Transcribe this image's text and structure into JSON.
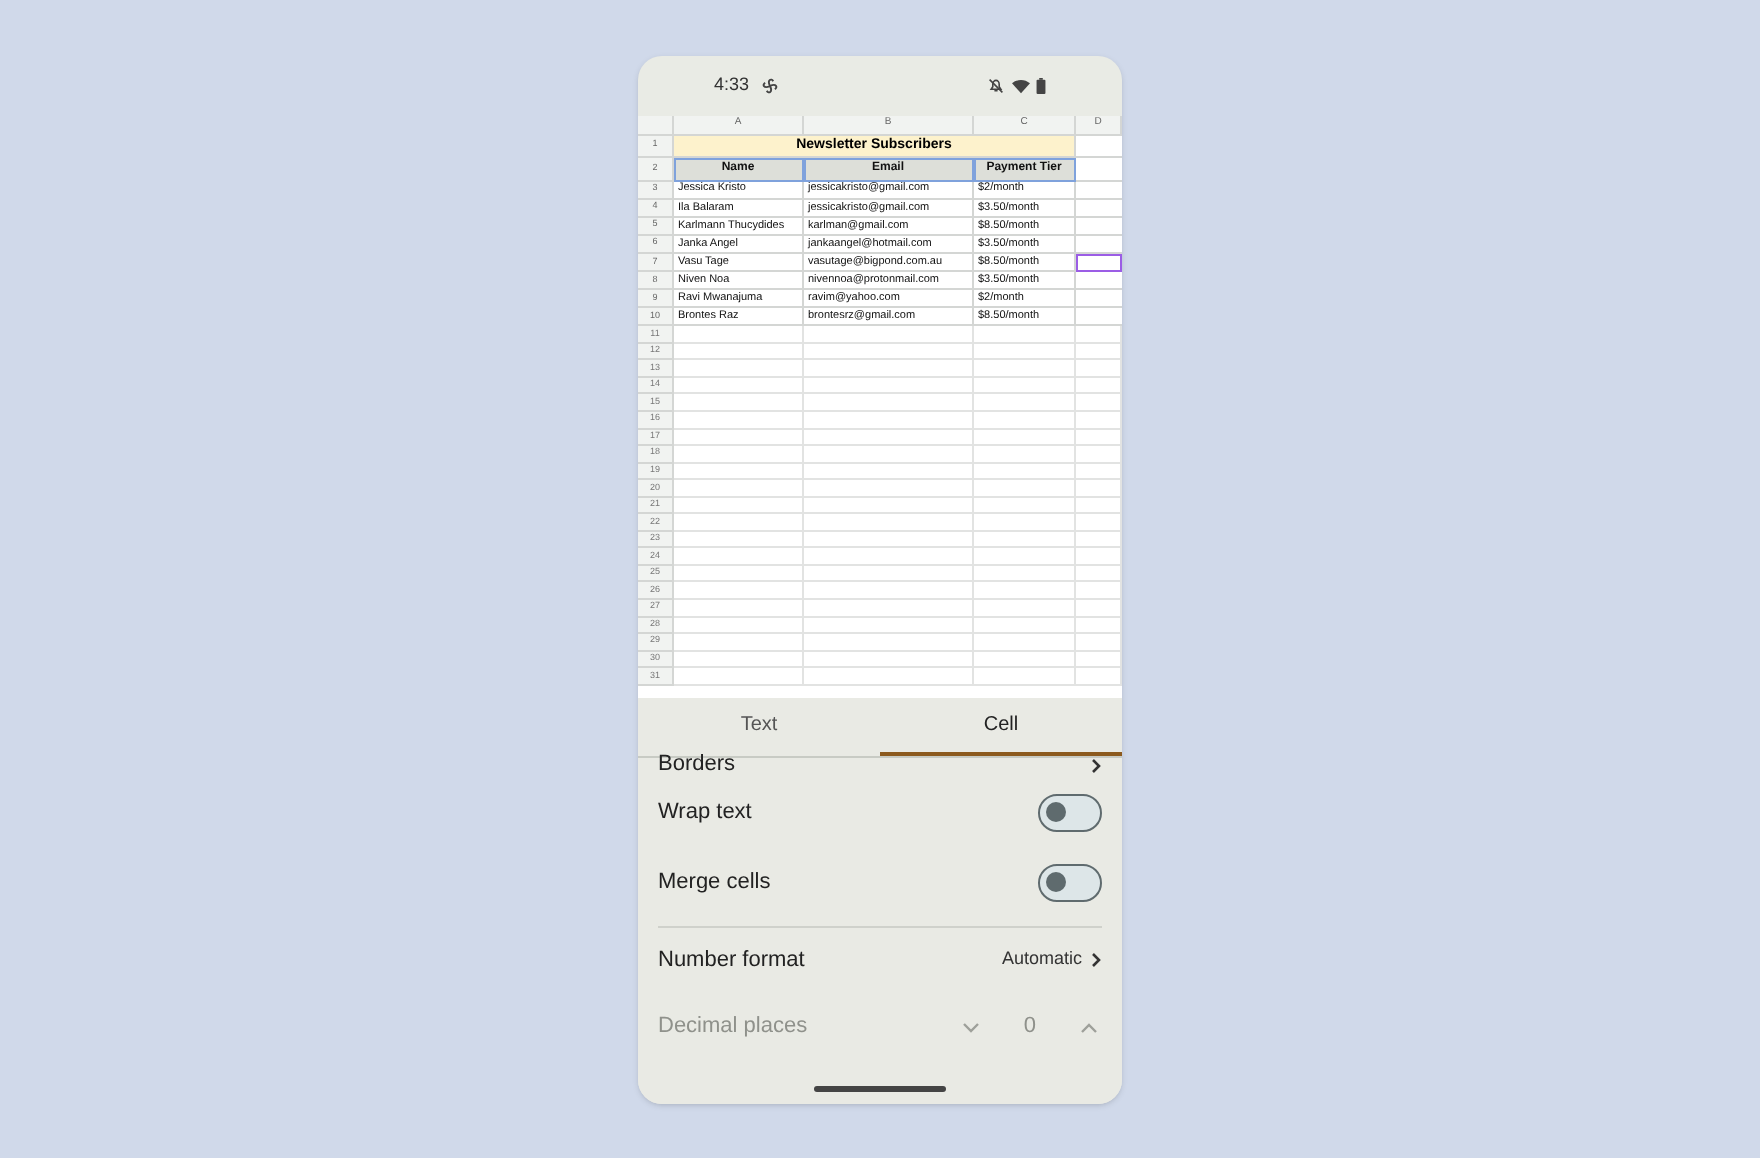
{
  "status_bar": {
    "time": "4:33"
  },
  "sheet": {
    "columns": [
      "A",
      "B",
      "C",
      "D"
    ],
    "rows": [
      {
        "number": "1",
        "kind": "title",
        "range_selected": false,
        "cursor": false,
        "title": "Newsletter Subscribers"
      },
      {
        "number": "2",
        "kind": "header",
        "range_selected": true,
        "cursor": false,
        "cells": [
          "Name",
          "Email",
          "Payment Tier"
        ]
      },
      {
        "number": "3",
        "kind": "data",
        "range_selected": false,
        "cursor": false,
        "cells": [
          "Jessica Kristo",
          "jessicakristo@gmail.com",
          "$2/month"
        ]
      },
      {
        "number": "4",
        "kind": "data",
        "range_selected": false,
        "cursor": false,
        "cells": [
          "Ila Balaram",
          "jessicakristo@gmail.com",
          "$3.50/month"
        ]
      },
      {
        "number": "5",
        "kind": "data",
        "range_selected": false,
        "cursor": false,
        "cells": [
          "Karlmann Thucydides",
          "karlman@gmail.com",
          "$8.50/month"
        ]
      },
      {
        "number": "6",
        "kind": "data",
        "range_selected": false,
        "cursor": false,
        "cells": [
          "Janka Angel",
          "jankaangel@hotmail.com",
          "$3.50/month"
        ]
      },
      {
        "number": "7",
        "kind": "data",
        "range_selected": false,
        "cursor": true,
        "cells": [
          "Vasu Tage",
          "vasutage@bigpond.com.au",
          "$8.50/month"
        ]
      },
      {
        "number": "8",
        "kind": "data",
        "range_selected": false,
        "cursor": false,
        "cells": [
          "Niven Noa",
          "nivennoa@protonmail.com",
          "$3.50/month"
        ]
      },
      {
        "number": "9",
        "kind": "data",
        "range_selected": false,
        "cursor": false,
        "cells": [
          "Ravi Mwanajuma",
          "ravim@yahoo.com",
          "$2/month"
        ]
      },
      {
        "number": "10",
        "kind": "data",
        "range_selected": false,
        "cursor": false,
        "cells": [
          "Brontes Raz",
          "brontesrz@gmail.com",
          "$8.50/month"
        ]
      }
    ],
    "empty_row_numbers": [
      "11",
      "12",
      "13",
      "14",
      "15",
      "16",
      "17",
      "18",
      "19",
      "20",
      "21",
      "22",
      "23",
      "24",
      "25",
      "26",
      "27",
      "28",
      "29",
      "30",
      "31"
    ]
  },
  "tabs": [
    {
      "label": "Text",
      "selected": false
    },
    {
      "label": "Cell",
      "selected": true
    }
  ],
  "options": [
    {
      "kind": "link",
      "label": "Borders"
    },
    {
      "kind": "toggle",
      "label": "Wrap text",
      "on": false
    },
    {
      "kind": "toggle",
      "label": "Merge cells",
      "on": false
    },
    {
      "kind": "link",
      "label": "Number format",
      "value": "Automatic"
    },
    {
      "kind": "stepper",
      "label": "Decimal places",
      "value": "0",
      "disabled": true
    }
  ]
}
